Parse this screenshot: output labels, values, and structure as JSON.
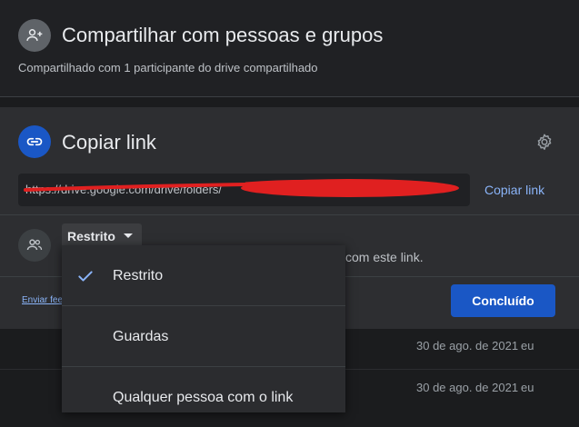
{
  "background_list": {
    "rows": [
      {
        "date": "30 de ago. de 2021",
        "owner": "eu"
      },
      {
        "date": "30 de ago. de 2021",
        "owner": "eu"
      }
    ]
  },
  "share": {
    "title": "Compartilhar com pessoas e grupos",
    "subtitle": "Compartilhado com 1 participante do drive compartilhado",
    "icon": "person-add-icon"
  },
  "link": {
    "title": "Copiar link",
    "url": "https://drive.google.com/drive/folders/",
    "copy_label": "Copiar link",
    "access_button_label": "Restrito",
    "description": "com este link.",
    "icon": "link-icon",
    "settings_icon": "gear-icon"
  },
  "footer": {
    "feedback_label": "Enviar fee",
    "done_label": "Concluído"
  },
  "dropdown": {
    "options": [
      {
        "label": "Restrito",
        "selected": true
      },
      {
        "label": "Guardas",
        "selected": false
      },
      {
        "label": "Qualquer pessoa com o link",
        "selected": false
      }
    ]
  },
  "colors": {
    "accent": "#1a57c5",
    "link_text": "#8ab4f8",
    "redaction": "#e02020"
  }
}
